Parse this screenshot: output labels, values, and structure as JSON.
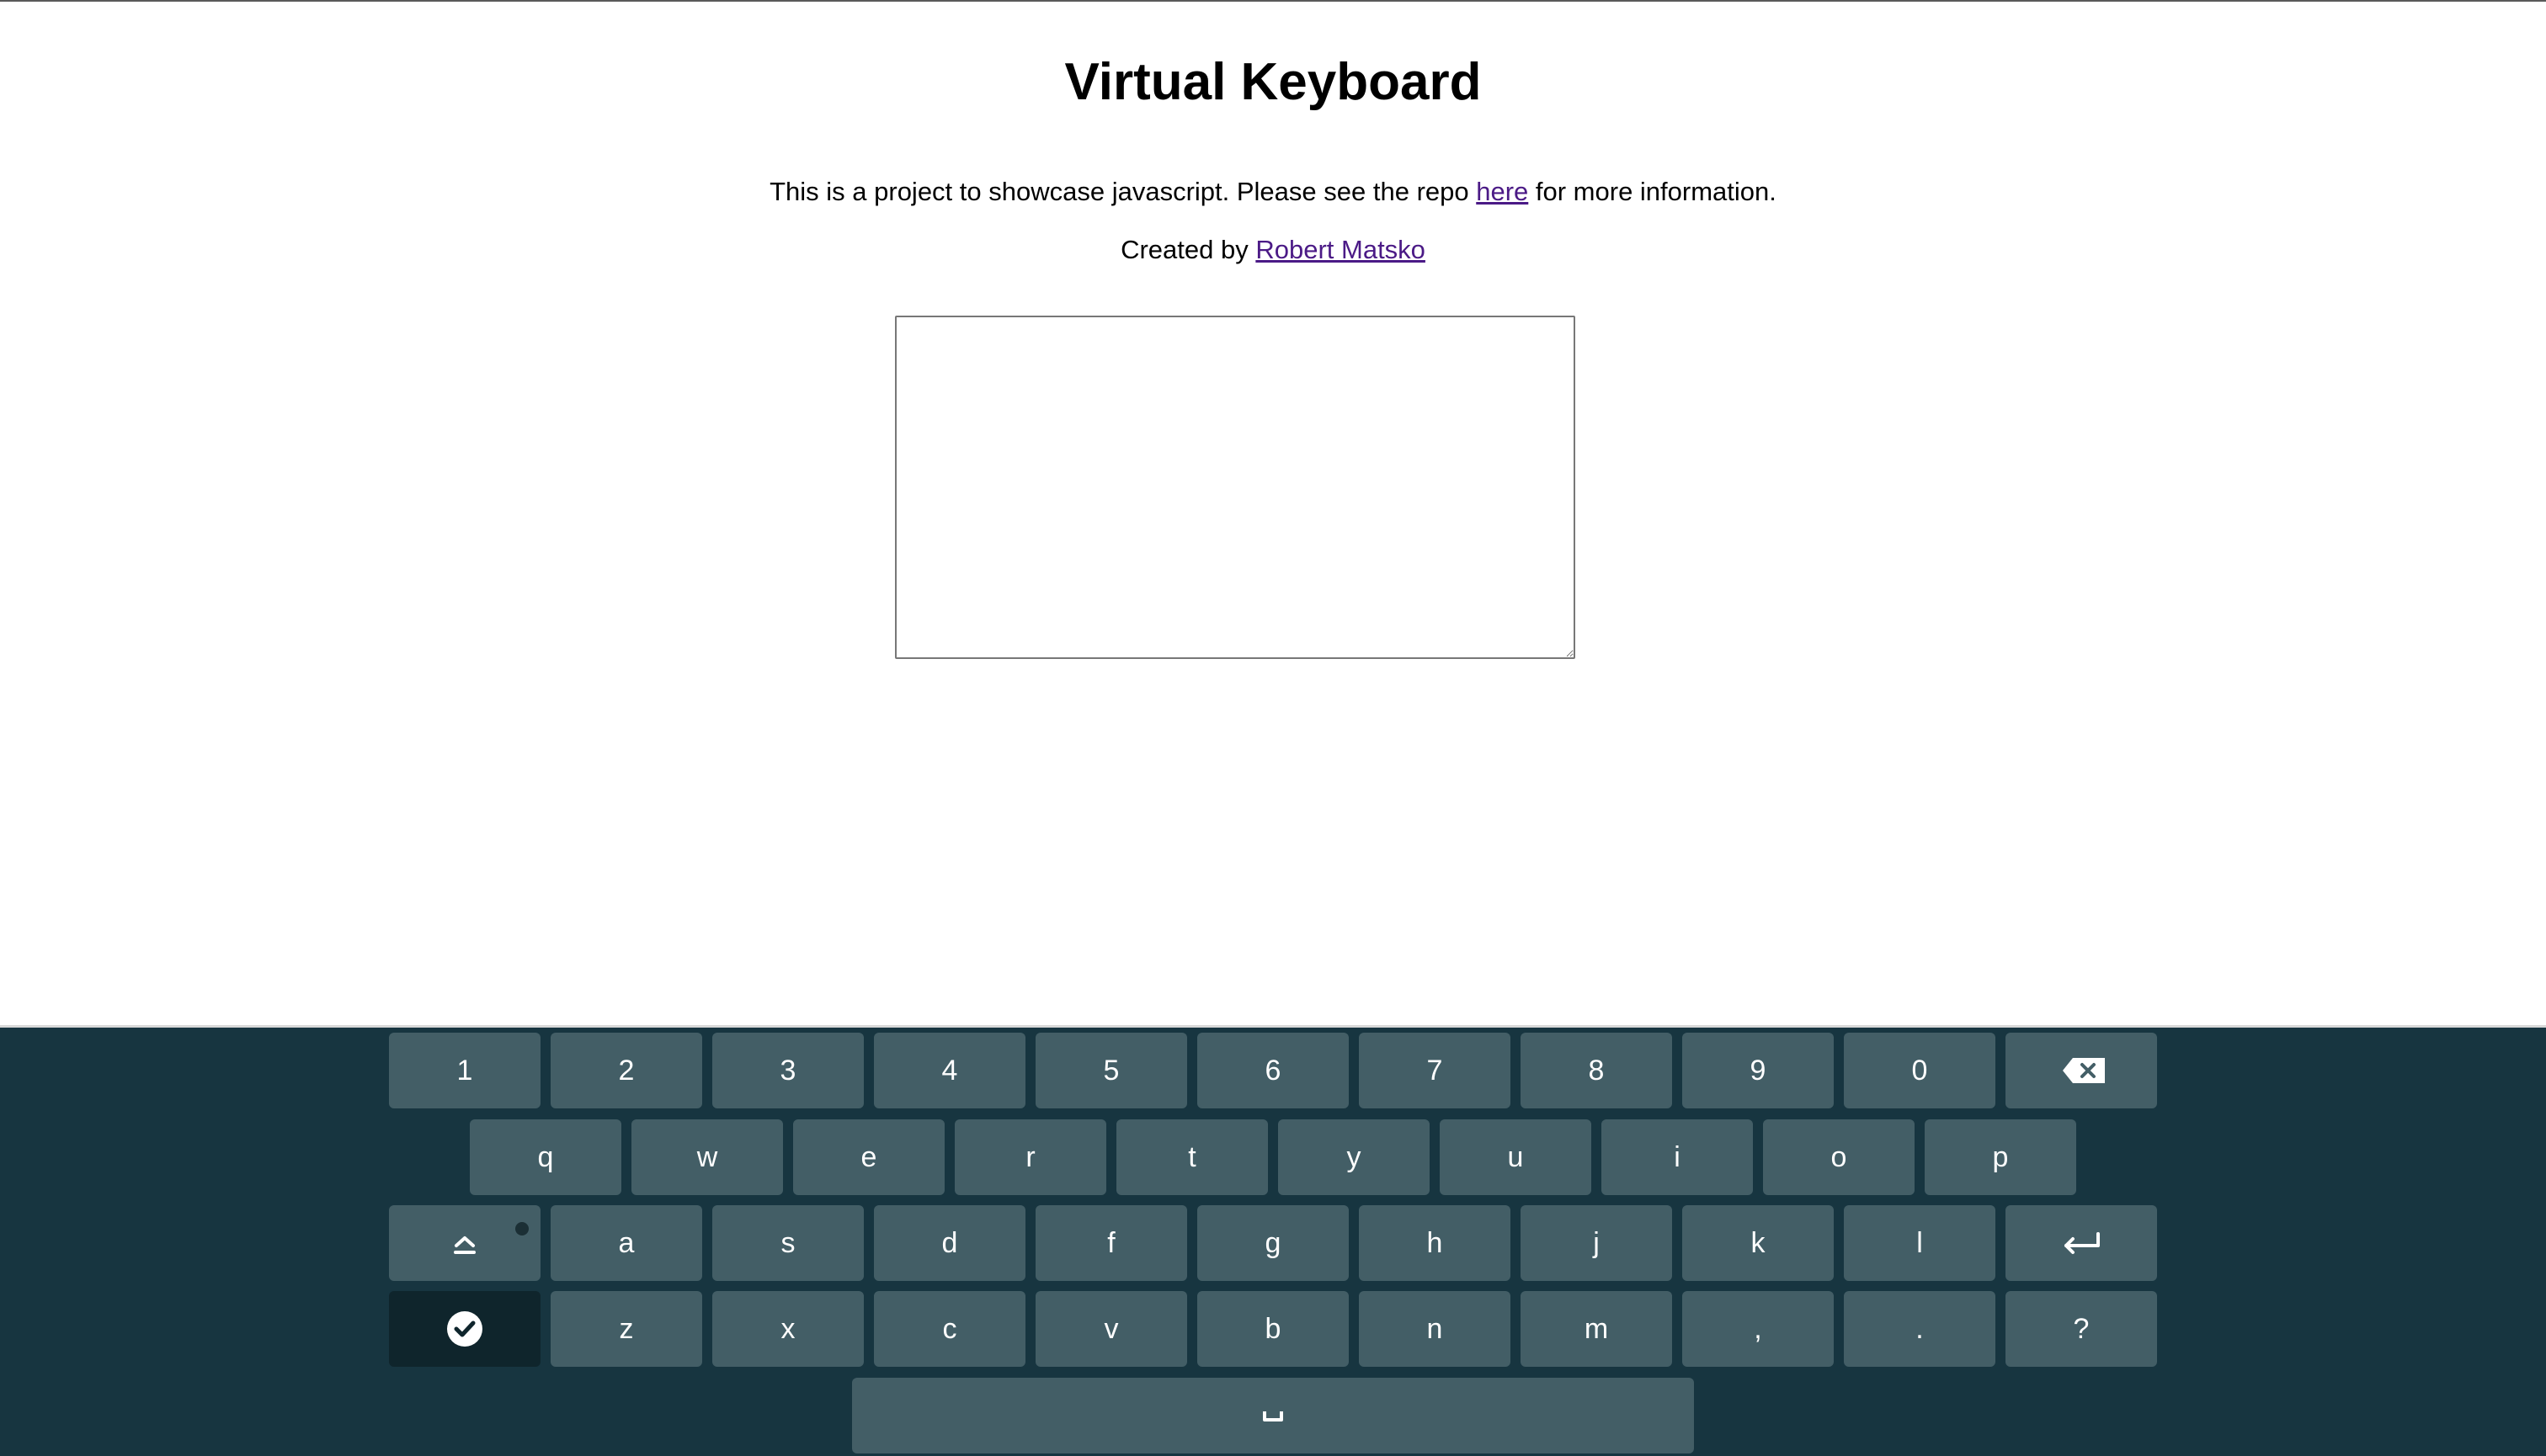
{
  "page": {
    "title": "Virtual Keyboard",
    "description_before": "This is a project to showcase javascript. Please see the repo ",
    "description_link": "here",
    "description_after": " for more information.",
    "credit_before": "Created by ",
    "credit_link": "Robert Matsko"
  },
  "editor": {
    "value": ""
  },
  "keyboard": {
    "row1": [
      "1",
      "2",
      "3",
      "4",
      "5",
      "6",
      "7",
      "8",
      "9",
      "0"
    ],
    "row2": [
      "q",
      "w",
      "e",
      "r",
      "t",
      "y",
      "u",
      "i",
      "o",
      "p"
    ],
    "row3": [
      "a",
      "s",
      "d",
      "f",
      "g",
      "h",
      "j",
      "k",
      "l"
    ],
    "row4": [
      "z",
      "x",
      "c",
      "v",
      "b",
      "n",
      "m",
      ",",
      ".",
      "?"
    ],
    "special": {
      "backspace": "backspace-icon",
      "caps": "caps-lock-icon",
      "enter": "enter-icon",
      "done": "check-circle-icon",
      "space": "space-icon"
    },
    "colors": {
      "background": "#173540",
      "key": "#435e66",
      "key_dark": "#0f252c",
      "text": "#ffffff",
      "link": "#4b1a86"
    }
  }
}
